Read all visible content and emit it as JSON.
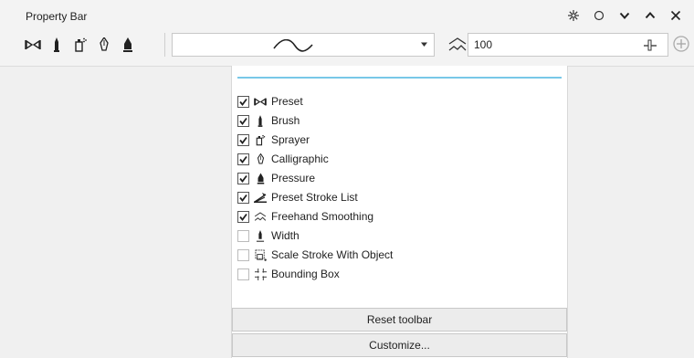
{
  "header": {
    "title": "Property Bar",
    "controls": [
      "settings-icon",
      "circle-icon",
      "chevron-down-icon",
      "chevron-up-icon",
      "close-icon"
    ]
  },
  "toolbar": {
    "tools": [
      "preset-icon",
      "brush-icon",
      "sprayer-icon",
      "calligraphic-icon",
      "pressure-icon"
    ],
    "stroke_preview": "wave-stroke",
    "smoothing_value": "100"
  },
  "panel": {
    "accent": "#78c8e8",
    "items": [
      {
        "label": "Preset",
        "checked": true,
        "icon": "preset-icon"
      },
      {
        "label": "Brush",
        "checked": true,
        "icon": "brush-icon"
      },
      {
        "label": "Sprayer",
        "checked": true,
        "icon": "sprayer-icon"
      },
      {
        "label": "Calligraphic",
        "checked": true,
        "icon": "calligraphic-icon"
      },
      {
        "label": "Pressure",
        "checked": true,
        "icon": "pressure-icon"
      },
      {
        "label": "Preset Stroke List",
        "checked": true,
        "icon": "stroke-list-icon"
      },
      {
        "label": "Freehand Smoothing",
        "checked": true,
        "icon": "smoothing-icon"
      },
      {
        "label": "Width",
        "checked": false,
        "icon": "width-icon"
      },
      {
        "label": "Scale Stroke With Object",
        "checked": false,
        "icon": "scale-stroke-icon"
      },
      {
        "label": "Bounding Box",
        "checked": false,
        "icon": "bounding-box-icon"
      }
    ],
    "reset_label": "Reset toolbar",
    "customize_label": "Customize..."
  }
}
